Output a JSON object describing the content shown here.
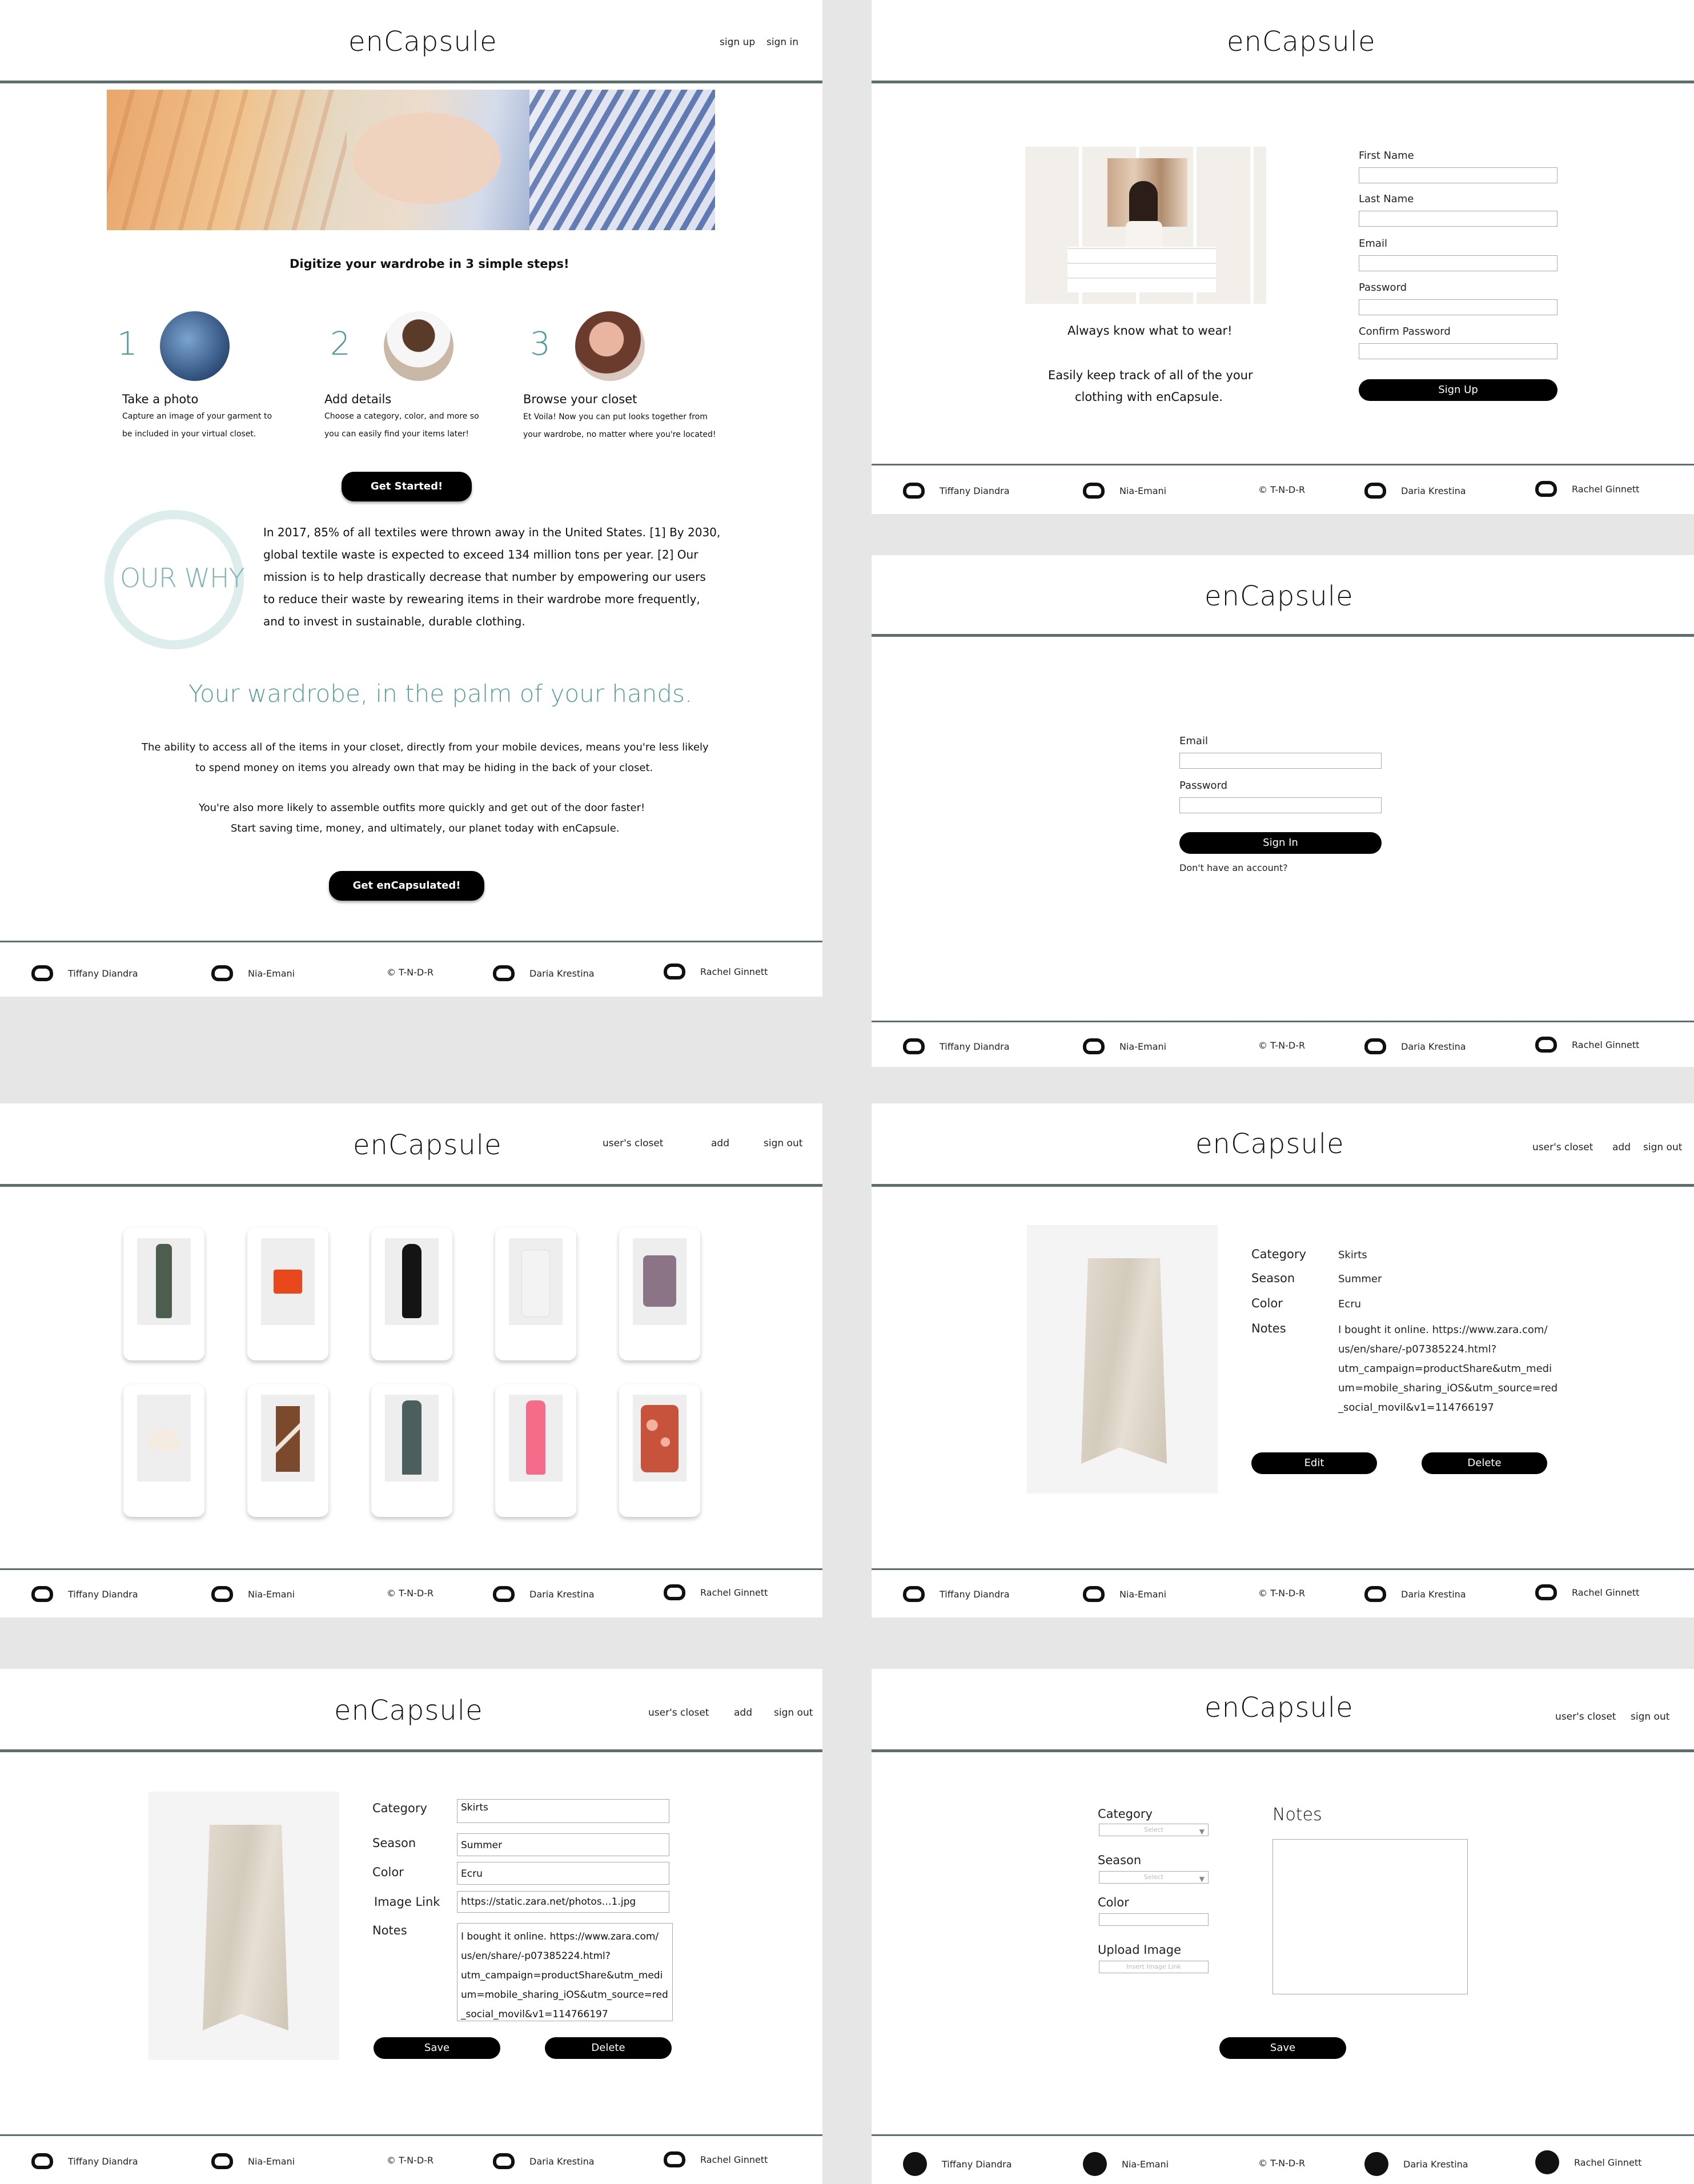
{
  "brand": "enCapsule",
  "footer": {
    "members": [
      "Tiffany Diandra",
      "Nia-Emani",
      "Daria Krestina",
      "Rachel Ginnett"
    ],
    "copyright": "© T-N-D-R"
  },
  "home": {
    "nav": [
      "sign up",
      "sign in"
    ],
    "tagline": "Digitize your wardrobe in 3 simple steps!",
    "steps": [
      {
        "num": "1",
        "title": "Take a photo",
        "desc1": "Capture an image of your garment to",
        "desc2": "be included in your virtual closet."
      },
      {
        "num": "2",
        "title": "Add details",
        "desc1": "Choose a category, color, and more so",
        "desc2": "you can easily find your items later!"
      },
      {
        "num": "3",
        "title": "Browse your closet",
        "desc1": "Et Voila! Now you can put looks together from",
        "desc2": "your wardrobe, no matter where you're located!"
      }
    ],
    "cta1": "Get Started!",
    "why_label": "OUR WHY",
    "why_lines": [
      "In 2017, 85% of all textiles were thrown away in the United States. [1]  By 2030,",
      "global textile waste is expected to exceed 134 million tons per year. [2]  Our",
      "mission is to help drastically decrease that number by empowering our users",
      "to reduce their waste by rewearing items in their wardrobe more frequently,",
      "and to invest in sustainable, durable clothing."
    ],
    "palm": "Your wardrobe, in the palm of your hands.",
    "para1": [
      "The ability to access all of the items in your closet, directly from your mobile devices, means you're less likely",
      "to spend money on items you already own that may be hiding in the back of your closet."
    ],
    "para2": [
      "You're also more likely to assemble outfits more quickly and get out of the door faster!",
      "Start saving time, money, and ultimately, our planet today with enCapsule."
    ],
    "cta2": "Get enCapsulated!"
  },
  "signup": {
    "line1": "Always know what to wear!",
    "line2": "Easily keep track of all of the your",
    "line3": "clothing with enCapsule.",
    "fields": [
      "First Name",
      "Last Name",
      "Email",
      "Password",
      "Confirm Password"
    ],
    "button": "Sign Up"
  },
  "signin": {
    "fields": [
      "Email",
      "Password"
    ],
    "button": "Sign In",
    "link": "Don't have an account?"
  },
  "closet": {
    "nav": [
      "user's closet",
      "add",
      "sign out"
    ]
  },
  "detail": {
    "nav": [
      "user's closet",
      "add",
      "sign out"
    ],
    "labels": [
      "Category",
      "Season",
      "Color",
      "Notes"
    ],
    "values": [
      "Skirts",
      "Summer",
      "Ecru"
    ],
    "notes": [
      "I bought it online. https://www.zara.com/",
      "us/en/share/-p07385224.html?",
      "utm_campaign=productShare&utm_medi",
      "um=mobile_sharing_iOS&utm_source=red",
      "_social_movil&v1=114766197"
    ],
    "edit": "Edit",
    "delete": "Delete"
  },
  "edit": {
    "nav": [
      "user's closet",
      "add",
      "sign out"
    ],
    "labels": [
      "Category",
      "Season",
      "Color",
      "Image Link",
      "Notes"
    ],
    "values": [
      "Skirts",
      "Summer",
      "Ecru",
      "https://static.zara.net/photos…1.jpg"
    ],
    "save": "Save",
    "delete": "Delete"
  },
  "add": {
    "nav": [
      "user's closet",
      "sign out"
    ],
    "labels": [
      "Category",
      "Season",
      "Color",
      "Upload Image"
    ],
    "select_placeholder": "Select",
    "image_placeholder": "Insert Image Link",
    "notes_label": "Notes",
    "save": "Save"
  }
}
